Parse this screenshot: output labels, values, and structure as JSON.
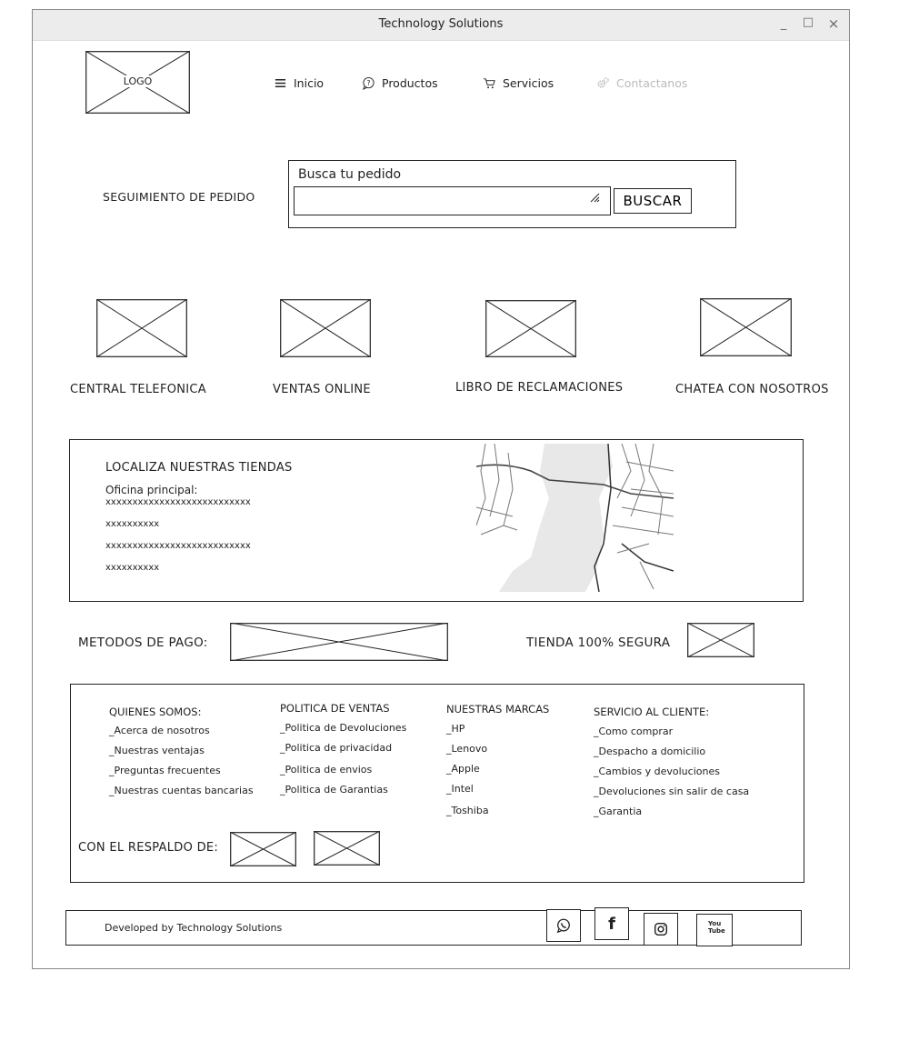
{
  "window": {
    "title": "Technology Solutions",
    "controls": {
      "minimize": "_",
      "maximize": "□",
      "close": "×"
    }
  },
  "header": {
    "logo": "LOGO",
    "nav": [
      {
        "label": "Inicio",
        "icon": "menu-icon",
        "state": "normal"
      },
      {
        "label": "Productos",
        "icon": "help-bubble-icon",
        "state": "normal"
      },
      {
        "label": "Servicios",
        "icon": "cart-icon",
        "state": "normal"
      },
      {
        "label": "Contactanos",
        "icon": "gears-icon",
        "state": "disabled"
      }
    ]
  },
  "tracking": {
    "label": "SEGUIMIENTO DE PEDIDO",
    "box_title": "Busca tu pedido",
    "input_value": "",
    "button": "BUSCAR"
  },
  "services": [
    {
      "label": "CENTRAL TELEFONICA"
    },
    {
      "label": "VENTAS ONLINE"
    },
    {
      "label": "LIBRO DE RECLAMACIONES"
    },
    {
      "label": "CHATEA CON NOSOTROS"
    }
  ],
  "stores": {
    "title": "LOCALIZA NUESTRAS TIENDAS",
    "office_label": "Oficina principal:",
    "lines": [
      "xxxxxxxxxxxxxxxxxxxxxxxxxxx",
      "xxxxxxxxxx",
      "xxxxxxxxxxxxxxxxxxxxxxxxxxx",
      "xxxxxxxxxx"
    ]
  },
  "payment": {
    "label": "METODOS DE PAGO:",
    "secure_label": "TIENDA 100% SEGURA"
  },
  "footer_links": {
    "columns": [
      {
        "heading": "QUIENES SOMOS:",
        "links": [
          "_Acerca de nosotros",
          "_Nuestras ventajas",
          "_Preguntas frecuentes",
          "_Nuestras cuentas bancarias"
        ]
      },
      {
        "heading": "POLITICA DE VENTAS",
        "links": [
          "_Politica de Devoluciones",
          "_Politica de privacidad",
          "_Politica de envios",
          "_Politica de Garantias"
        ]
      },
      {
        "heading": "NUESTRAS MARCAS",
        "links": [
          "_HP",
          "_Lenovo",
          "_Apple",
          "_Intel",
          "_Toshiba"
        ]
      },
      {
        "heading": "SERVICIO AL CLIENTE:",
        "links": [
          "_Como comprar",
          "_Despacho a domicilio",
          "_Cambios y devoluciones",
          "_Devoluciones sin salir de casa",
          "_Garantia"
        ]
      }
    ],
    "backing_label": "CON EL RESPALDO DE:"
  },
  "bottom_bar": {
    "credit": "Developed by Technology Solutions",
    "social": [
      {
        "icon": "whatsapp-icon"
      },
      {
        "icon": "facebook-icon",
        "text": "f"
      },
      {
        "icon": "instagram-icon"
      },
      {
        "icon": "youtube-icon",
        "text": "You Tube"
      }
    ]
  },
  "colors": {
    "line": "#222222",
    "titlebar": "#ececec",
    "disabled_text": "#bbbbbb",
    "map_land": "#e8e8e8"
  }
}
